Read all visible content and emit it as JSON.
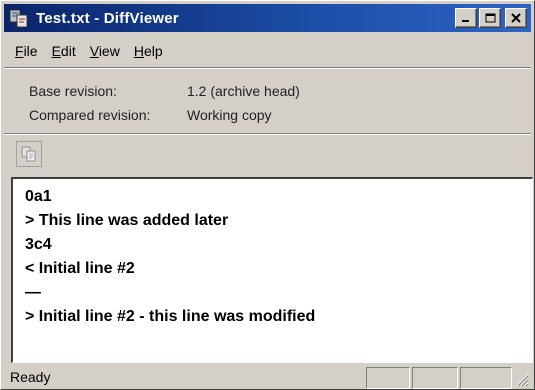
{
  "window": {
    "title": "Test.txt - DiffViewer",
    "controls": {
      "minimize": "_",
      "maximize": "□",
      "close": "×"
    }
  },
  "menu": [
    {
      "label": "File",
      "accel": "F",
      "rest": "ile"
    },
    {
      "label": "Edit",
      "accel": "E",
      "rest": "dit"
    },
    {
      "label": "View",
      "accel": "V",
      "rest": "iew"
    },
    {
      "label": "Help",
      "accel": "H",
      "rest": "elp"
    }
  ],
  "info": {
    "base_label": "Base revision:",
    "base_value": "1.2 (archive head)",
    "compared_label": "Compared revision:",
    "compared_value": "Working copy"
  },
  "toolbar": {
    "copy_icon": "copy-icon"
  },
  "diff_lines": [
    "0a1",
    "> This line was added later",
    "3c4",
    "< Initial line #2",
    "—",
    "> Initial line #2 - this line was modified"
  ],
  "status": {
    "text": "Ready"
  },
  "colors": {
    "titlebar_start": "#0a246a",
    "titlebar_end": "#2d64c4",
    "face": "#d4d0c8"
  }
}
